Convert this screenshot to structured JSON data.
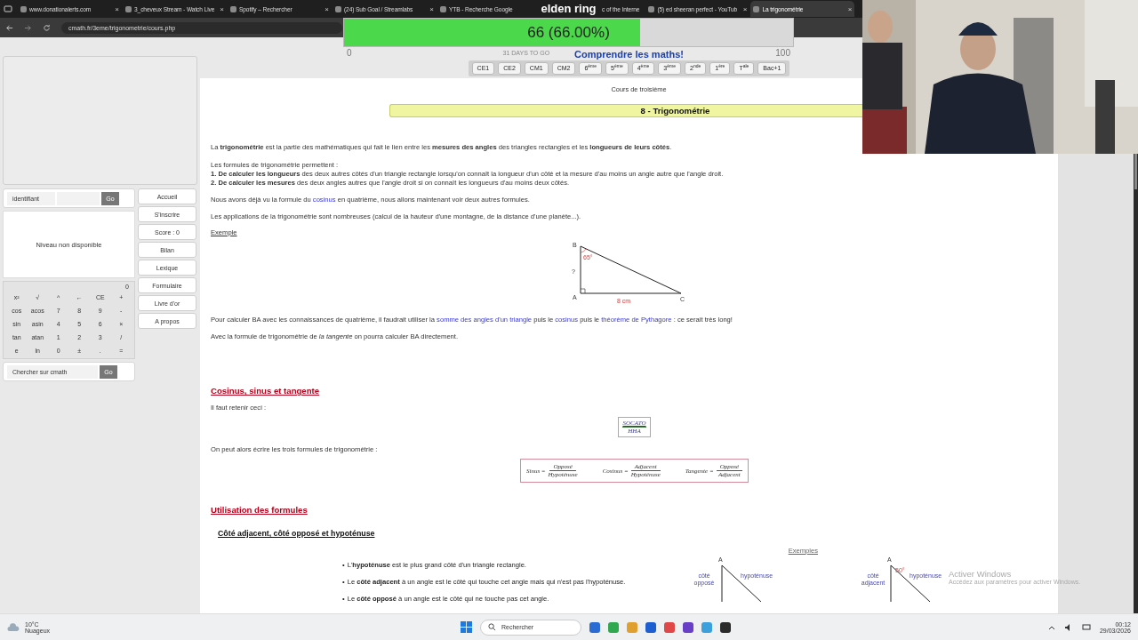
{
  "browser": {
    "tabs": [
      {
        "title": "www.donationalerts.com",
        "selected": false,
        "close": "×"
      },
      {
        "title": "3_cheveux Stream - Watch Live",
        "selected": false,
        "close": "×"
      },
      {
        "title": "Spotify – Rechercher",
        "selected": false,
        "close": "×"
      },
      {
        "title": "(24) Sub Goal / Streamlabs",
        "selected": false,
        "close": "×"
      },
      {
        "title": "YTB - Recherche Google",
        "selected": false
      },
      {
        "title": "c of the Interne",
        "selected": false,
        "kind": "partial"
      },
      {
        "title": "(5) ed sheeran perfect - YouTub",
        "selected": false,
        "close": "×"
      },
      {
        "title": "La trigonométrie",
        "selected": true,
        "close": "×"
      }
    ],
    "address": "cmath.fr/3eme/trigonometrie/cours.php"
  },
  "goal_overlay": {
    "title": "elden ring",
    "reading": "66 (66.00%)",
    "level": 0.66,
    "min": "0",
    "max": "100",
    "subtitle": "31 DAYS TO GO"
  },
  "site": {
    "logo": "Comprendre les maths!",
    "levels": [
      "CE1",
      "CE2",
      "CM1",
      "CM2",
      "6$^{ème}$",
      "5$^{ème}$",
      "4$^{ème}$",
      "3$^{ème}$",
      "2$^{nde}$",
      "1$^{ère}$",
      "T$^{ale}$",
      "Bac+1"
    ],
    "login": {
      "placeholder": "identifiant",
      "button": "Go"
    },
    "level_box": "Niveau non disponible",
    "calculator": {
      "display": "0",
      "keys": [
        "x²",
        "√",
        "^",
        "←",
        "CE",
        "+",
        "cos",
        "acos",
        "7",
        "8",
        "9",
        "-",
        "sin",
        "asin",
        "4",
        "5",
        "6",
        "×",
        "tan",
        "atan",
        "1",
        "2",
        "3",
        "/",
        "e",
        "ln",
        "0",
        "±",
        ".",
        "="
      ]
    },
    "search": {
      "placeholder": "Chercher sur cmath",
      "button": "Go"
    },
    "menu": [
      "Accueil",
      "S'inscrire",
      "Score : 0",
      "Bilan",
      "Lexique",
      "Formulaire",
      "Livre d'or",
      "A propos"
    ]
  },
  "course": {
    "level": "Cours de troisième",
    "title": "8 - Trigonométrie",
    "intro": [
      [
        {
          "kind": "text",
          "text": "La **trigonométrie** est la partie des mathématiques qui fait le lien entre les **mesures des angles** des triangles rectangles et les **longueurs de leurs côtés**."
        }
      ],
      [
        {
          "kind": "text",
          "text": "Les formules de trigonométrie permettent :"
        }
      ],
      [
        {
          "kind": "text",
          "text": "**1. De calculer les longueurs** des deux autres côtés d'un triangle rectangle lorsqu'on connaît la longueur d'un côté et la mesure d'au moins un angle autre que l'angle droit."
        }
      ],
      [
        {
          "kind": "text",
          "text": "**2. De calculer les mesures** des deux angles autres que l'angle droit si on connaît les longueurs d'au moins deux côtés."
        }
      ],
      [
        {
          "kind": "text",
          "text": "Nous avons déjà vu la formule du "
        },
        {
          "kind": "link",
          "text": "cosinus"
        },
        {
          "kind": "text",
          "text": " en quatrième, nous allons maintenant voir deux autres formules."
        }
      ],
      [
        {
          "kind": "text",
          "text": "Les applications de la trigonométrie sont nombreuses (calcul de la hauteur d'une montagne, de la distance d'une planète...)."
        }
      ]
    ],
    "example_label": "Exemple",
    "triangle": {
      "b": "B",
      "angle": "65°",
      "unknown": "?",
      "a": "A",
      "base": "8 cm",
      "c": "C"
    },
    "after": [
      [
        {
          "kind": "text",
          "text": "Pour calculer BA avec les connaissances de quatrième, il faudrait utiliser la "
        },
        {
          "kind": "link",
          "text": "somme des angles d'un triangle"
        },
        {
          "kind": "text",
          "text": " puis le "
        },
        {
          "kind": "link",
          "text": "cosinus"
        },
        {
          "kind": "text",
          "text": " puis le "
        },
        {
          "kind": "link",
          "text": "théorème de Pythagore"
        },
        {
          "kind": "text",
          "text": " : ce serait très long!"
        }
      ],
      [
        {
          "kind": "text",
          "text": "Avec la formule de trigonométrie de *la tangente* on pourra calculer BA directement."
        }
      ]
    ],
    "section1": "Cosinus, sinus et tangente",
    "remember": "Il faut retenir ceci :",
    "mnemonic": {
      "top": "SOCATO",
      "bottom": "HHA"
    },
    "formulas_intro": "On peut alors écrire les trois formules de trigonométrie :",
    "formulas": [
      {
        "name": "Sinus =",
        "numerator": "Opposé",
        "denominator": "Hypoténuse"
      },
      {
        "name": "Cosinus =",
        "numerator": "Adjacent",
        "denominator": "Hypoténuse"
      },
      {
        "name": "Tangente =",
        "numerator": "Opposé",
        "denominator": "Adjacent"
      }
    ],
    "section2": "Utilisation des formules",
    "subsection": "Côté adjacent, côté opposé et hypoténuse",
    "examples_link": "Exemples",
    "bullets": [
      {
        "marker": "•",
        "text": "L'**hypoténuse** est le plus grand côté d'un triangle rectangle."
      },
      {
        "marker": "•",
        "text": "Le **côté adjacent** à un angle est le côté qui touche cet angle mais qui n'est pas l'hypoténuse."
      },
      {
        "marker": "•",
        "text": "Le **côté opposé** à un angle est le côté qui ne touche pas cet angle."
      }
    ],
    "example_figures": [
      {
        "vertex": "A",
        "side": "côté opposé",
        "hyp": "hypoténuse"
      },
      {
        "vertex": "A",
        "angle": "50°",
        "side": "côté adjacent",
        "hyp": "hypoténuse"
      }
    ]
  },
  "activation": {
    "title": "Activer Windows",
    "hint": "Accédez aux paramètres pour activer Windows."
  },
  "taskbar": {
    "temperature": "10°C",
    "weather": "Nuageux",
    "search": "Rechercher",
    "time": "00:12",
    "date": "29/03/2026"
  }
}
